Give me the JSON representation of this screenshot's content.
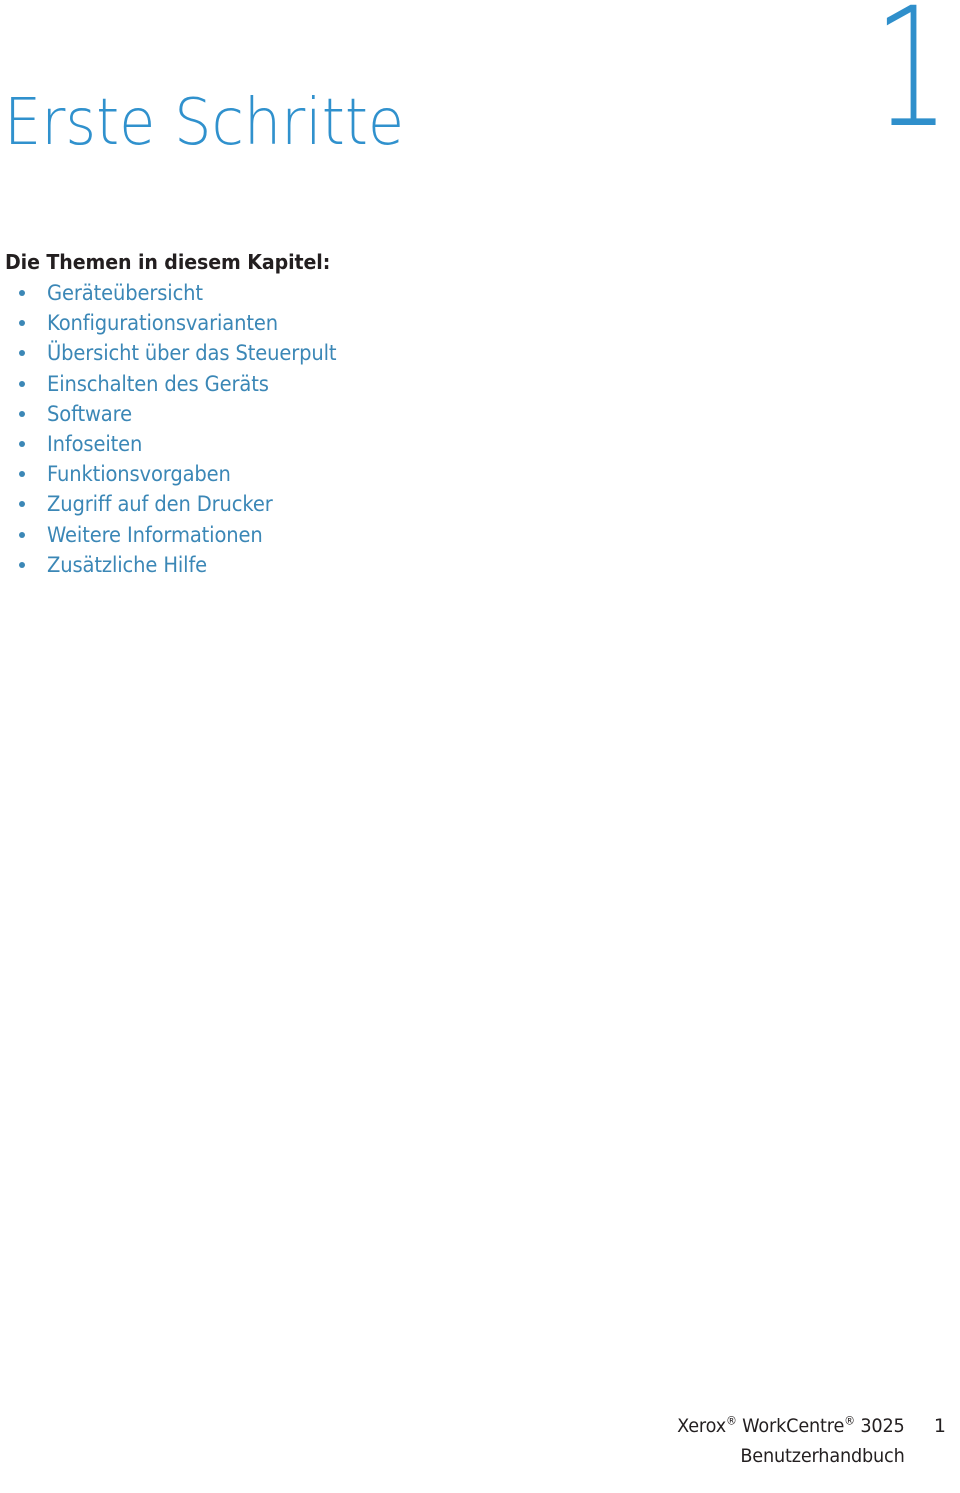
{
  "document": {
    "chapter_number": "1",
    "chapter_title": "Erste Schritte",
    "topics_heading": "Die Themen in diesem Kapitel:",
    "topics": [
      {
        "label": "Geräteübersicht"
      },
      {
        "label": "Konfigurationsvarianten"
      },
      {
        "label": "Übersicht über das Steuerpult"
      },
      {
        "label": "Einschalten des Geräts"
      },
      {
        "label": "Software"
      },
      {
        "label": "Infoseiten"
      },
      {
        "label": "Funktionsvorgaben"
      },
      {
        "label": "Zugriff auf den Drucker"
      },
      {
        "label": "Weitere Informationen"
      },
      {
        "label": "Zusätzliche Hilfe"
      }
    ]
  },
  "footer": {
    "product_brand": "Xerox",
    "product_line": "WorkCentre",
    "product_model": "3025",
    "registered_mark": "®",
    "document_type": "Benutzerhandbuch",
    "page_number": "1"
  },
  "colors": {
    "title_blue": "#3091cd",
    "chapter_number_blue": "#2f8fcb",
    "list_blue": "#3b87b6",
    "heading_black": "#231f20",
    "page_background": "#ffffff"
  }
}
